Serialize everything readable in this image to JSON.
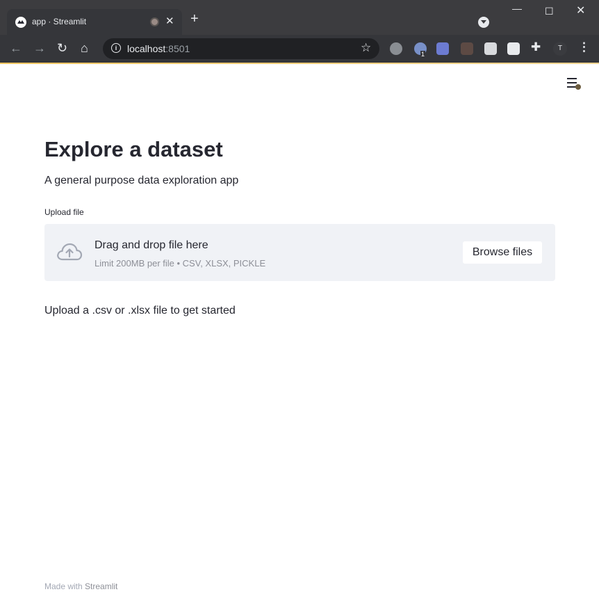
{
  "browser": {
    "tab": {
      "title": "app · Streamlit",
      "close_glyph": "✕"
    },
    "new_tab_glyph": "+",
    "window_controls": {
      "minimize": "—",
      "maximize": "☐",
      "close": "✕"
    },
    "nav": {
      "back": "←",
      "forward": "→",
      "reload": "↻",
      "home": "⌂"
    },
    "address": {
      "host": "localhost",
      "port": ":8501",
      "info_glyph": "i",
      "star_glyph": "☆"
    },
    "extensions": {
      "badge": "1",
      "puzzle_glyph": "✚",
      "avatar": "T",
      "menu_glyph": "⋮"
    }
  },
  "page": {
    "title": "Explore a dataset",
    "subtitle": "A general purpose data exploration app",
    "uploader": {
      "label": "Upload file",
      "drop_text": "Drag and drop file here",
      "limit_text": "Limit 200MB per file • CSV, XLSX, PICKLE",
      "button_label": "Browse files"
    },
    "hint": "Upload a .csv or .xlsx file to get started",
    "footer": {
      "prefix": "Made with ",
      "brand": "Streamlit"
    }
  }
}
